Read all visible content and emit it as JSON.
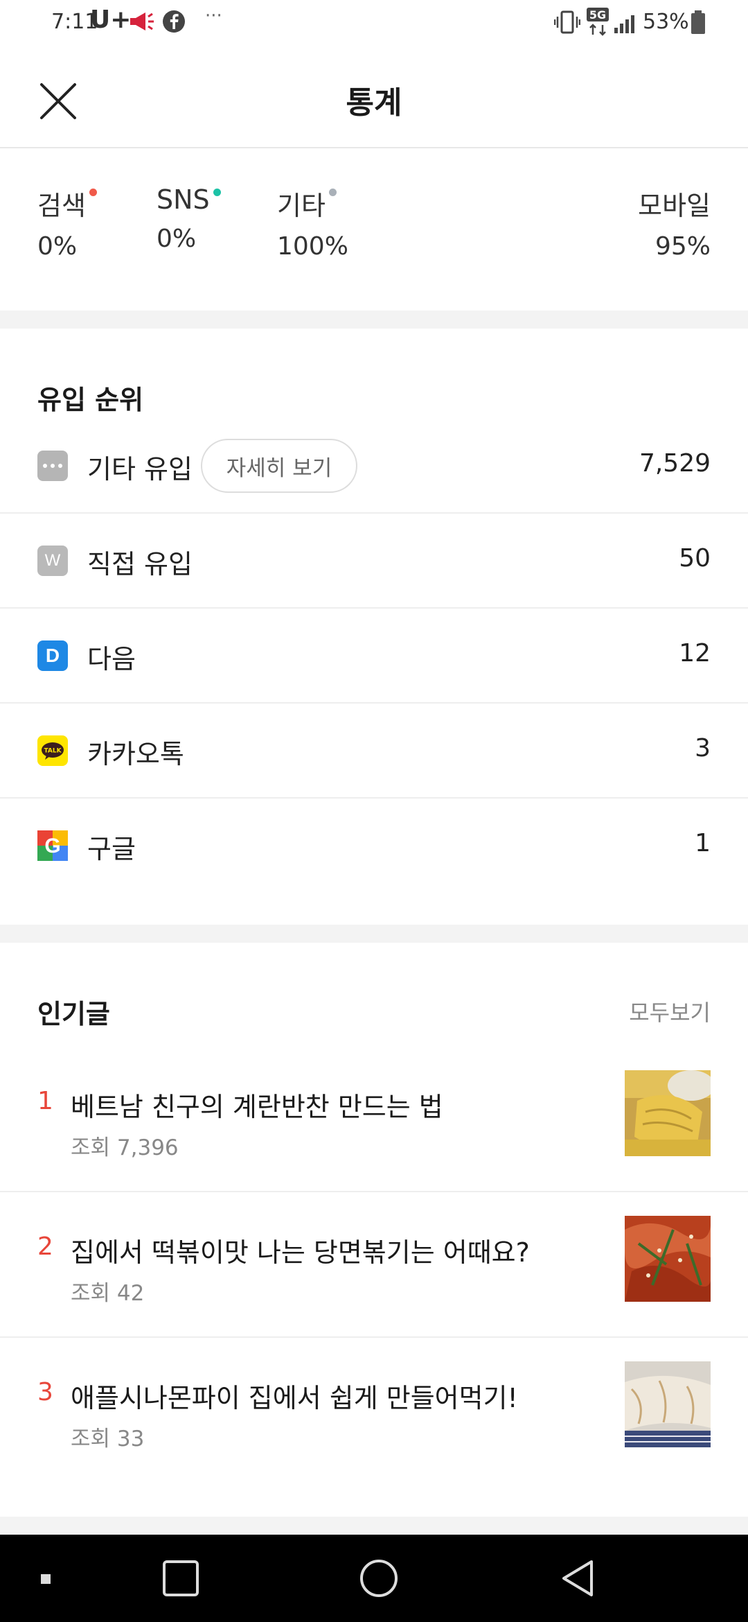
{
  "status_bar": {
    "time": "7:11",
    "carrier": "U+",
    "network": "5G",
    "battery": "53%",
    "icons": [
      "megaphone-icon",
      "facebook-icon",
      "more-dots-icon",
      "vibrate-icon",
      "network-5g-icon",
      "signal-icon",
      "battery-icon"
    ]
  },
  "header": {
    "title": "통계",
    "close_icon": "close-icon"
  },
  "source_ratio": {
    "items": [
      {
        "label": "검색",
        "value": "0%",
        "dot_color": "#f05a4a"
      },
      {
        "label": "SNS",
        "value": "0%",
        "dot_color": "#1cc2a6"
      },
      {
        "label": "기타",
        "value": "100%",
        "dot_color": "#a9b0b8"
      }
    ],
    "mobile": {
      "label": "모바일",
      "value": "95%"
    }
  },
  "inflow": {
    "title": "유입 순위",
    "detail_button": "자세히 보기",
    "rows": [
      {
        "label": "기타 유입",
        "value": "7,529",
        "icon": "more-icon",
        "icon_bg": "#b5b5b5"
      },
      {
        "label": "직접 유입",
        "value": "50",
        "icon": "w-icon",
        "icon_text": "W",
        "icon_bg": "#b9b9b9"
      },
      {
        "label": "다음",
        "value": "12",
        "icon": "daum-icon",
        "icon_text": "D",
        "icon_bg": "#1e88e5"
      },
      {
        "label": "카카오톡",
        "value": "3",
        "icon": "kakaotalk-icon",
        "icon_text": "TALK",
        "icon_bg": "#fee500"
      },
      {
        "label": "구글",
        "value": "1",
        "icon": "google-icon",
        "icon_text": "G",
        "icon_bg": "#ffffff"
      }
    ]
  },
  "popular": {
    "title": "인기글",
    "view_all": "모두보기",
    "posts": [
      {
        "rank": "1",
        "title": "베트남 친구의 계란반찬 만드는 법",
        "views": "조회 7,396"
      },
      {
        "rank": "2",
        "title": "집에서 떡볶이맛 나는 당면볶기는 어때요?",
        "views": "조회 42"
      },
      {
        "rank": "3",
        "title": "애플시나몬파이 집에서 쉽게 만들어먹기!",
        "views": "조회 33"
      }
    ]
  },
  "nav_bar": {
    "icons": [
      "recent-dot-icon",
      "overview-square-icon",
      "home-circle-icon",
      "back-triangle-icon"
    ]
  }
}
